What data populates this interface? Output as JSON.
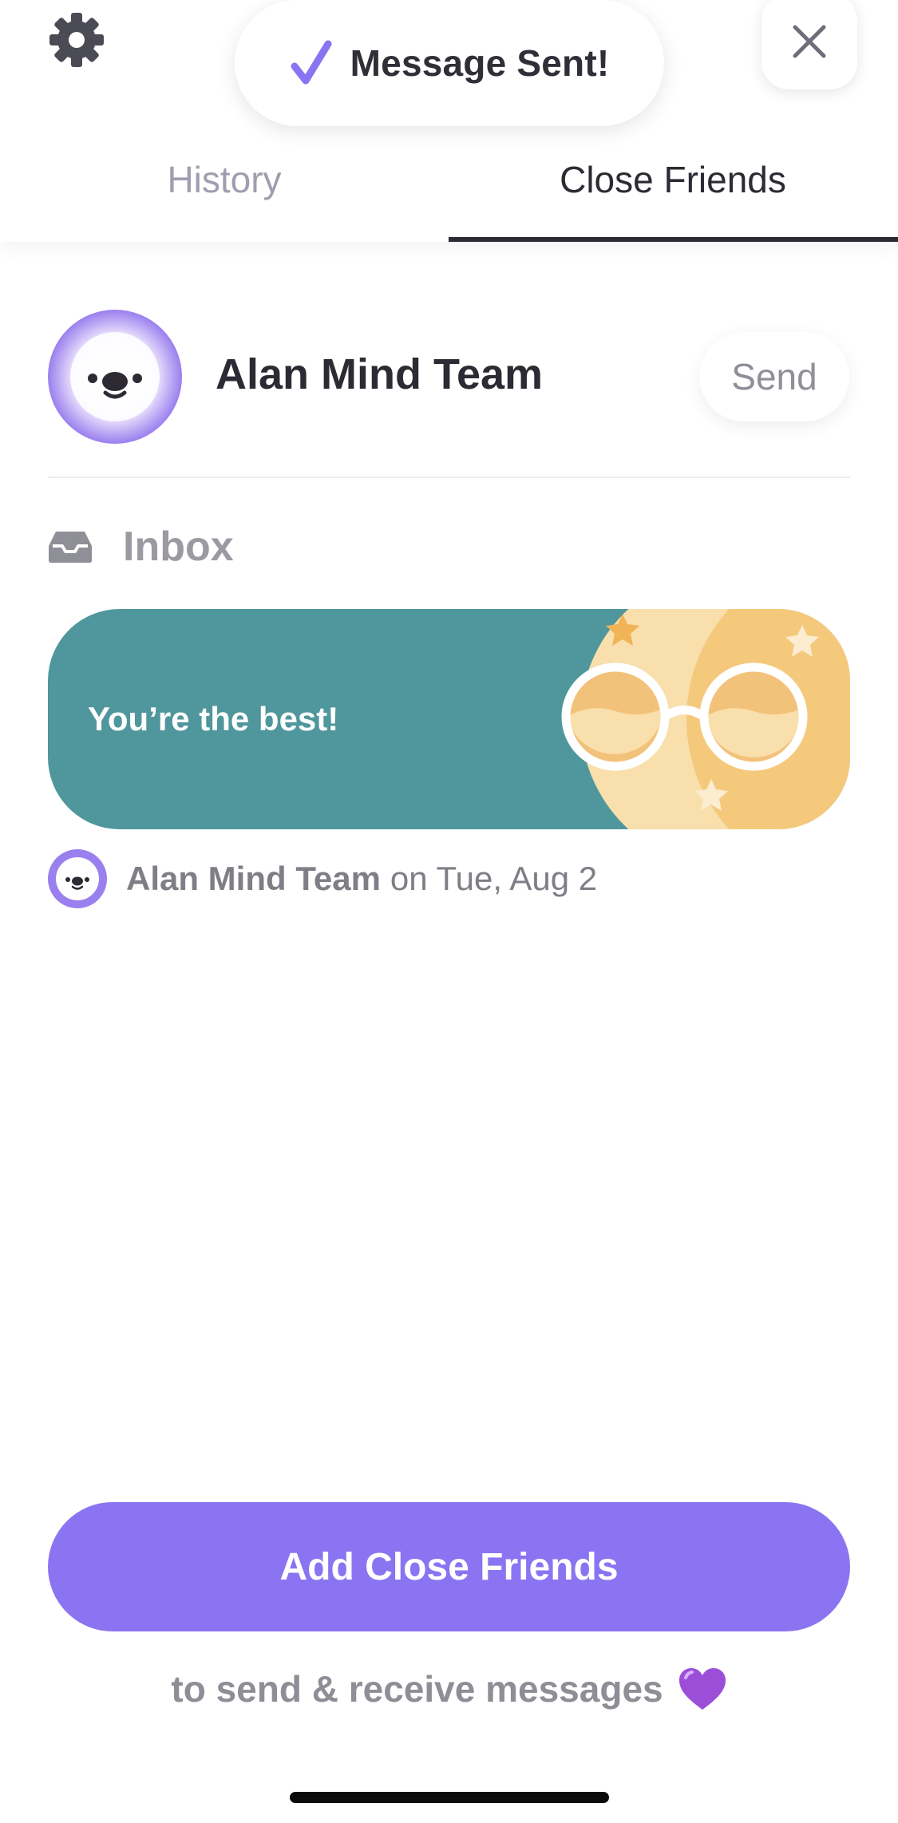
{
  "toast": {
    "message": "Message Sent!",
    "icon": "checkmark-icon"
  },
  "header": {
    "settings_icon": "gear-icon",
    "close_icon": "close-icon",
    "tabs": [
      {
        "label": "History",
        "active": false
      },
      {
        "label": "Close Friends",
        "active": true
      }
    ]
  },
  "contact": {
    "name": "Alan Mind Team",
    "send_label": "Send",
    "avatar_icon": "bear-face-avatar-icon"
  },
  "inbox": {
    "label": "Inbox",
    "icon": "inbox-tray-icon",
    "messages": [
      {
        "text": "You’re the best!",
        "art": "glasses-stars-illustration",
        "sender": "Alan Mind Team",
        "date": "on Tue, Aug 2"
      }
    ]
  },
  "footer": {
    "add_label": "Add Close Friends",
    "note": "to send & receive messages",
    "note_icon": "purple-heart-icon"
  },
  "colors": {
    "accent": "#8b74f2",
    "card_teal": "#4f979c",
    "card_yellow": "#f5c97c",
    "card_cream": "#f8dfab",
    "text_dark": "#2b2b33",
    "text_muted": "#9a9aa2"
  }
}
